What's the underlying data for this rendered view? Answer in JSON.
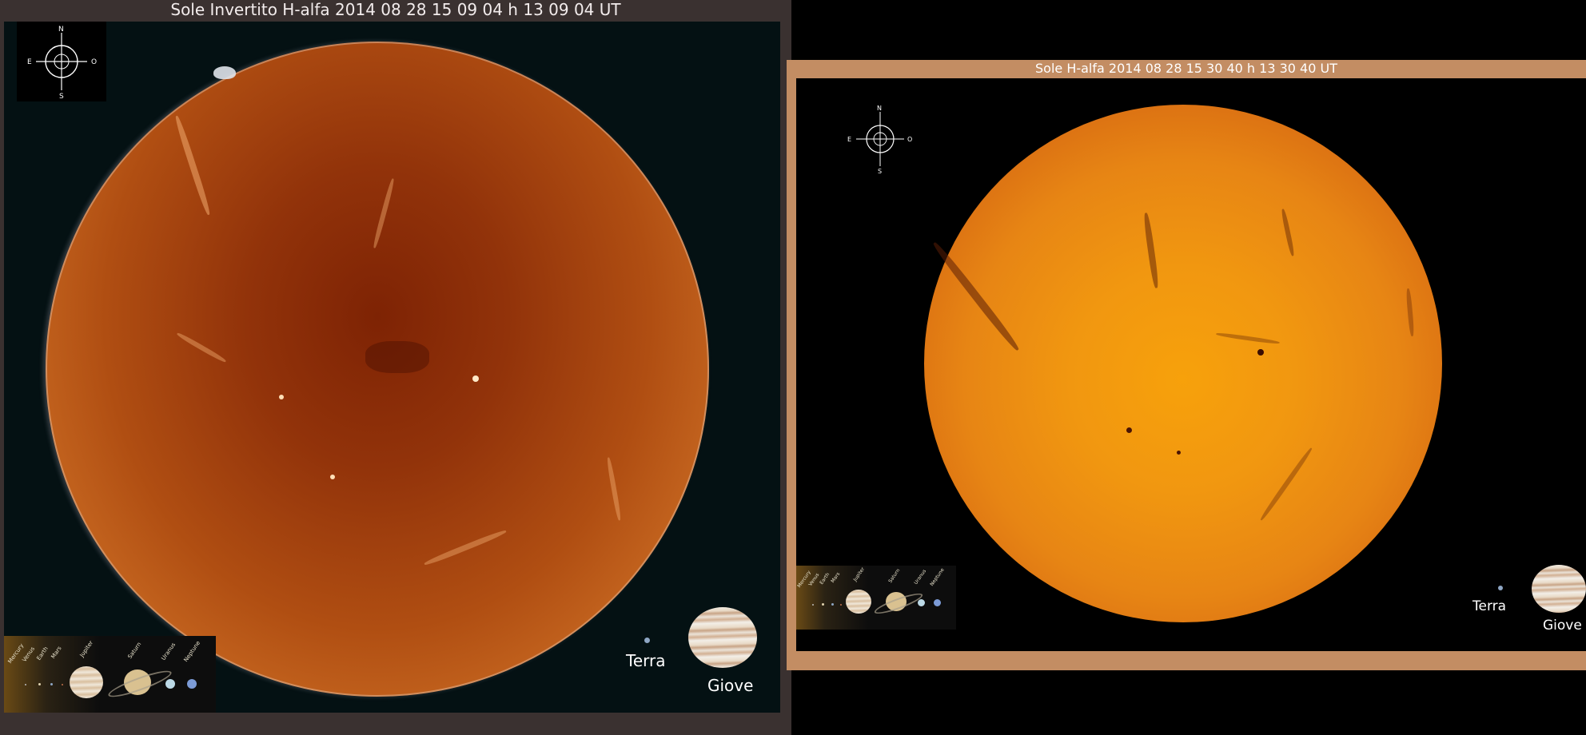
{
  "left_panel": {
    "title": "Sole Invertito H-alfa 2014 08 28 15 09 04 h 13 09 04 UT",
    "compass": {
      "north": "N",
      "south": "S",
      "east": "E",
      "west": "O"
    },
    "legend_planets": [
      "Mercury",
      "Venus",
      "Earth",
      "Mars",
      "Jupiter",
      "Saturn",
      "Uranus",
      "Neptune"
    ],
    "earth_label": "Terra",
    "jupiter_label": "Giove"
  },
  "right_panel": {
    "title": "Sole H-alfa 2014 08 28 15 30 40 h 13 30 40 UT",
    "compass": {
      "north": "N",
      "south": "S",
      "east": "E",
      "west": "O"
    },
    "legend_planets": [
      "Mercury",
      "Venus",
      "Earth",
      "Mars",
      "Jupiter",
      "Saturn",
      "Uranus",
      "Neptune"
    ],
    "earth_label": "Terra",
    "jupiter_label": "Giove"
  },
  "colors": {
    "left_background": "#3a3130",
    "right_border": "#c38d63",
    "inverted_sun": "#b04e12",
    "normal_sun": "#f19710"
  }
}
